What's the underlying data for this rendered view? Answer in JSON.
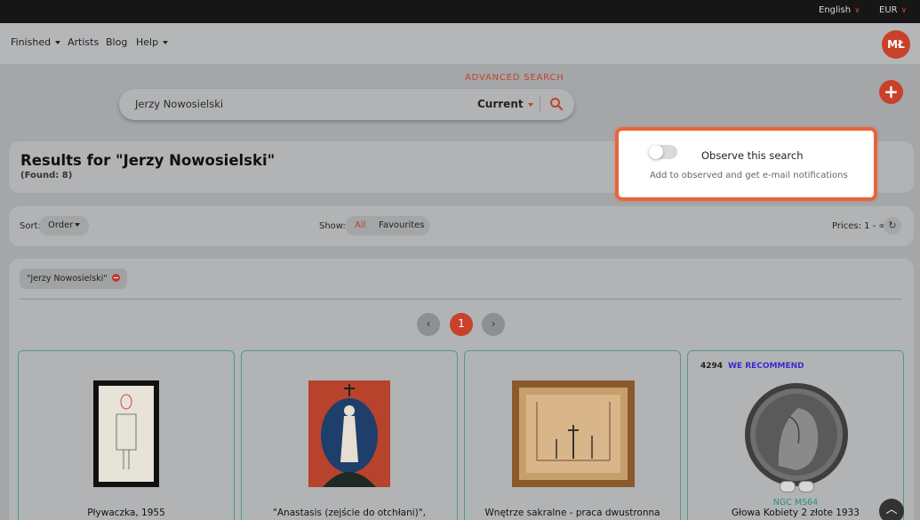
{
  "topbar": {
    "language": "English",
    "currency": "EUR"
  },
  "nav": {
    "items": [
      {
        "label": "Finished",
        "has_dropdown": true
      },
      {
        "label": "Artists",
        "has_dropdown": false
      },
      {
        "label": "Blog",
        "has_dropdown": false
      },
      {
        "label": "Help",
        "has_dropdown": true
      }
    ],
    "avatar_initials": "MŁ"
  },
  "search": {
    "advanced_label": "ADVANCED SEARCH",
    "query": "Jerzy Nowosielski",
    "scope": "Current",
    "add_icon": "plus-icon"
  },
  "results": {
    "title": "Results for \"Jerzy Nowosielski\"",
    "found": "(Found: 8)"
  },
  "filters": {
    "sort_label": "Sort:",
    "sort_value": "Order",
    "show_label": "Show:",
    "show_all": "All",
    "show_favourites": "Favourites",
    "prices_label": "Prices: 1 - ∞",
    "refresh_icon": "refresh-icon"
  },
  "active_filter_chip": "\"Jerzy Nowosielski\"",
  "pagination": {
    "prev": "‹",
    "current": "1",
    "next": "›"
  },
  "products": [
    {
      "title": "Pływaczka, 1955"
    },
    {
      "title": "\"Anastasis (zejście do otchłani)\","
    },
    {
      "title": "Wnętrze sakralne - praca dwustronna"
    },
    {
      "title": "Głowa Kobiety 2 złote 1933",
      "lot": "4294",
      "badge": "WE RECOMMEND",
      "grade": "NGC MS64"
    }
  ],
  "observe_popup": {
    "title": "Observe this search",
    "subtitle": "Add to observed and get e-mail notifications",
    "enabled": false
  },
  "colors": {
    "accent": "#c9412b",
    "highlight_border": "#e8643c",
    "card_border": "#4e9b86",
    "recommend": "#3c2ad0"
  }
}
